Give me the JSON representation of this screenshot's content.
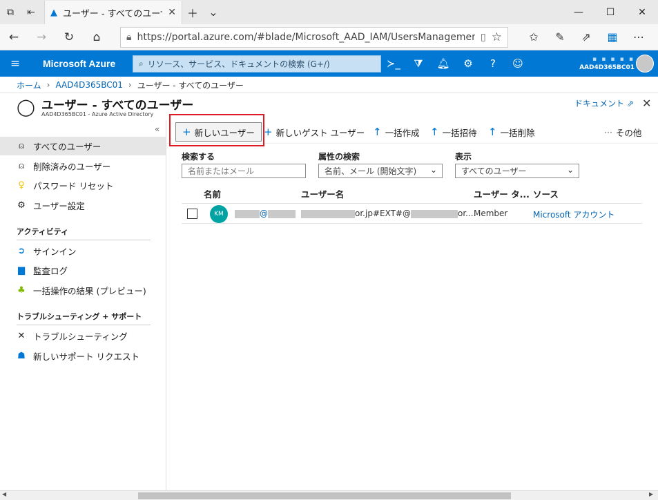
{
  "browser": {
    "tab_title": "ユーザー - すべてのユーザー -",
    "url": "https://portal.azure.com/#blade/Microsoft_AAD_IAM/UsersManagementMenuBlade"
  },
  "azure": {
    "brand": "Microsoft Azure",
    "search_placeholder": "リソース、サービス、ドキュメントの検索 (G+/)",
    "account_tenant": "AAD4D365BC01"
  },
  "breadcrumb": {
    "home": "ホーム",
    "tenant": "AAD4D365BC01",
    "current": "ユーザー - すべてのユーザー"
  },
  "blade": {
    "title": "ユーザー - すべてのユーザー",
    "subtitle": "AAD4D365BC01 - Azure Active Directory",
    "docs_link": "ドキュメント"
  },
  "nav": {
    "items": [
      {
        "label": "すべてのユーザー"
      },
      {
        "label": "削除済みのユーザー"
      },
      {
        "label": "パスワード リセット"
      },
      {
        "label": "ユーザー設定"
      }
    ],
    "activity_header": "アクティビティ",
    "activity_items": [
      {
        "label": "サインイン"
      },
      {
        "label": "監査ログ"
      },
      {
        "label": "一括操作の結果 (プレビュー)"
      }
    ],
    "support_header": "トラブルシューティング + サポート",
    "support_items": [
      {
        "label": "トラブルシューティング"
      },
      {
        "label": "新しいサポート リクエスト"
      }
    ]
  },
  "toolbar": {
    "new_user": "新しいユーザー",
    "new_guest": "新しいゲスト ユーザー",
    "bulk_create": "一括作成",
    "bulk_invite": "一括招待",
    "bulk_delete": "一括削除",
    "more": "その他"
  },
  "filters": {
    "search_label": "検索する",
    "search_placeholder": "名前またはメール",
    "attr_label": "属性の検索",
    "attr_value": "名前、メール (開始文字)",
    "show_label": "表示",
    "show_value": "すべてのユーザー"
  },
  "table": {
    "headers": {
      "name": "名前",
      "username": "ユーザー名",
      "usertype": "ユーザー タ...",
      "source": "ソース"
    },
    "rows": [
      {
        "avatar_text": "KM",
        "name_sep": "@",
        "username_mid": "or.jp#EXT#@",
        "username_end": "or....",
        "usertype": "Member",
        "source": "Microsoft アカウント"
      }
    ]
  }
}
